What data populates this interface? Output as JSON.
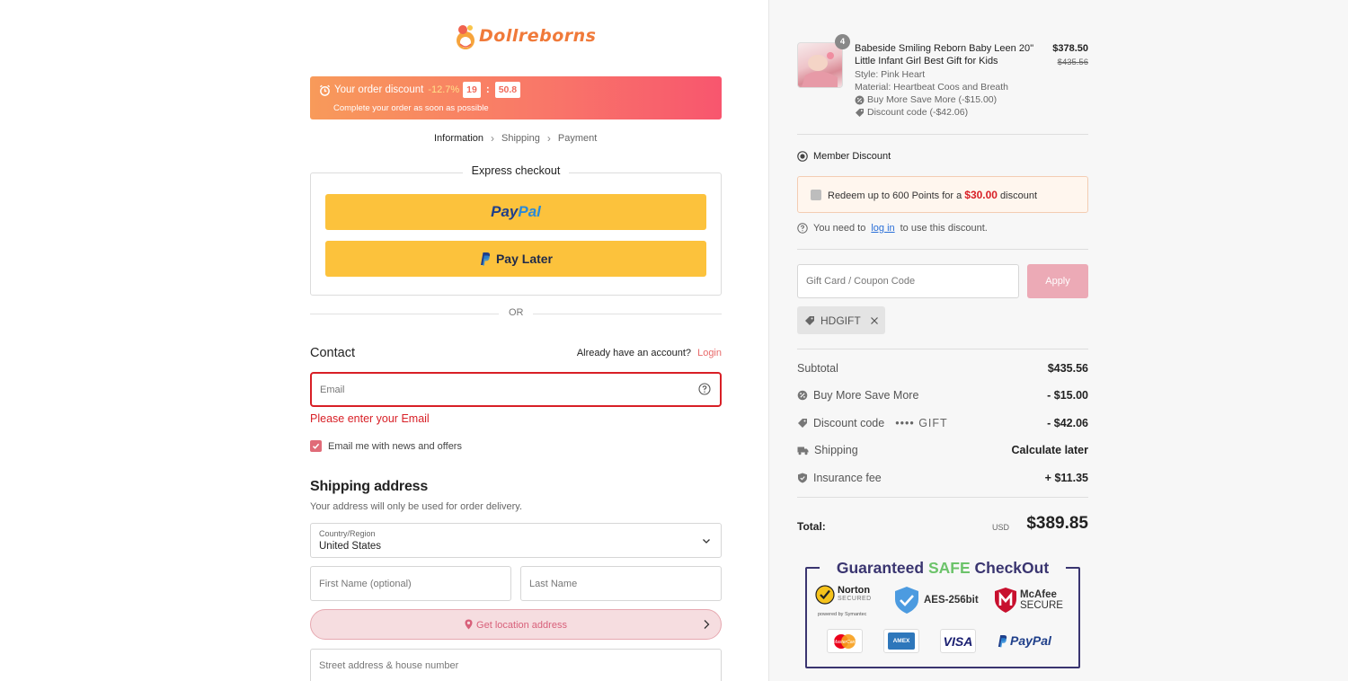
{
  "brand": {
    "logo_text": "Dollreborns"
  },
  "discount_bar": {
    "label": "Your order discount",
    "percent": "-12.7%",
    "timer_min": "19",
    "timer_sec": "50.8",
    "subtext": "Complete your order as soon as possible"
  },
  "breadcrumb": {
    "items": [
      "Information",
      "Shipping",
      "Payment"
    ]
  },
  "express": {
    "title": "Express checkout",
    "paypal_label_1": "Pay",
    "paypal_label_2": "Pal",
    "paylater_label": "Pay Later"
  },
  "divider_text": "OR",
  "contact": {
    "heading": "Contact",
    "account_prompt": "Already have an account?",
    "login_link": "Login",
    "email_placeholder": "Email",
    "email_error": "Please enter your Email",
    "newsletter_label": "Email me with news and offers",
    "newsletter_checked": true
  },
  "shipping": {
    "heading": "Shipping address",
    "subtext": "Your address will only be used for order delivery.",
    "country_label": "Country/Region",
    "country_value": "United States",
    "first_name_placeholder": "First Name (optional)",
    "last_name_placeholder": "Last Name",
    "location_button": "Get location address",
    "street_placeholder": "Street address & house number"
  },
  "cart": {
    "item": {
      "qty": "4",
      "name": "Babeside Smiling Reborn Baby Leen 20'' Little Infant Girl Best Gift for Kids",
      "style": "Style: Pink Heart",
      "material": "Material: Heartbeat Coos and Breath",
      "promo": "Buy More Save More (-$15.00)",
      "discount": "Discount code (-$42.06)",
      "price": "$378.50",
      "original_price": "$435.56"
    }
  },
  "member": {
    "heading": "Member Discount",
    "redeem_prefix": "Redeem up to 600 Points for a",
    "redeem_amount": "$30.00",
    "redeem_suffix": "discount",
    "login_prefix": "You need to",
    "login_link": "log in",
    "login_suffix": "to use this discount."
  },
  "coupon": {
    "placeholder": "Gift Card / Coupon Code",
    "apply_label": "Apply",
    "applied_code": "HDGIFT"
  },
  "summary": {
    "subtotal_label": "Subtotal",
    "subtotal_value": "$435.56",
    "bmsm_label": "Buy More Save More",
    "bmsm_value": "- $15.00",
    "discount_label": "Discount code",
    "discount_mask": "•••• GIFT",
    "discount_value": "- $42.06",
    "shipping_label": "Shipping",
    "shipping_value": "Calculate later",
    "insurance_label": "Insurance fee",
    "insurance_value": "+ $11.35",
    "total_label": "Total:",
    "currency": "USD",
    "total_value": "$389.85"
  },
  "safe_checkout": {
    "title_prefix": "Guaranteed",
    "title_highlight": "SAFE",
    "title_suffix": "CheckOut",
    "norton_name": "Norton",
    "norton_sub": "SECURED",
    "norton_powered": "powered by Symantec",
    "aes_label": "AES-256bit",
    "mcafee_name": "McAfee",
    "mcafee_sub": "SECURE",
    "mastercard": "MasterCard",
    "amex": "AMEX",
    "visa": "VISA",
    "paypal": "PayPal"
  },
  "colors": {
    "accent": "#e86a6a",
    "error": "#d81f26",
    "paypal_yellow": "#fcc23c",
    "apply_pink": "#ecaab6",
    "safe_navy": "#3a3570",
    "safe_green": "#6cc36a"
  }
}
